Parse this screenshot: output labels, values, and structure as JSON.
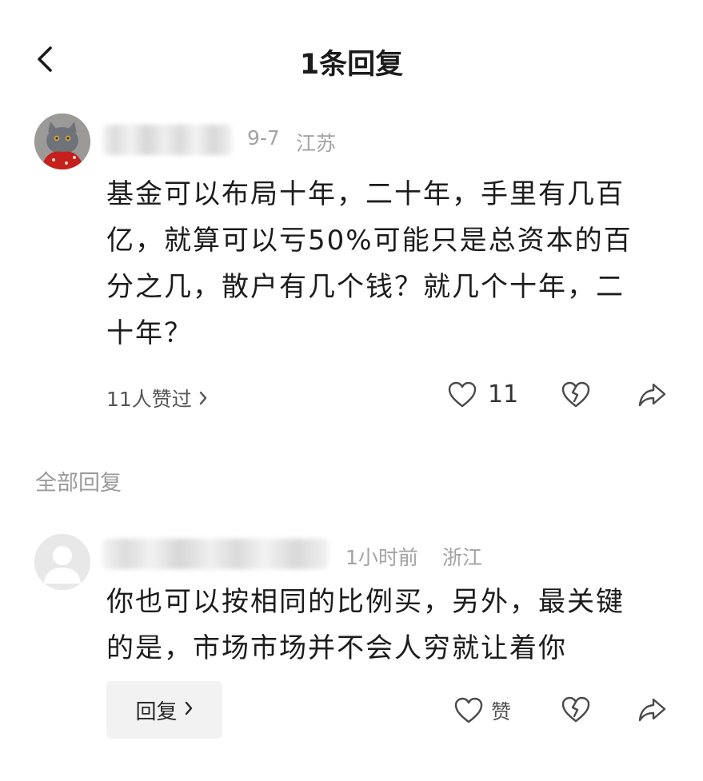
{
  "header": {
    "title": "1条回复",
    "back_icon": "chevron-left-icon"
  },
  "main_comment": {
    "date": "9-7",
    "location": "江苏",
    "lines": [
      "基金可以布局十年，二十年，手里有几百",
      "亿，就算可以亏50%可能只是总资本的百",
      "分之几，散户有几个钱？就几个十年，二",
      "十年？"
    ],
    "likes_link": "11人赞过",
    "like_count": "11"
  },
  "section": {
    "label": "全部回复"
  },
  "reply": {
    "time": "1小时前",
    "location": "浙江",
    "lines": [
      "你也可以按相同的比例买，另外，最关键",
      "的是，市场市场并不会人穷就让着你"
    ],
    "reply_button": "回复",
    "like_label": "赞"
  },
  "colors": {
    "text": "#1c1c1c",
    "muted": "#a3a3a3",
    "icon": "#4a4a4a"
  }
}
